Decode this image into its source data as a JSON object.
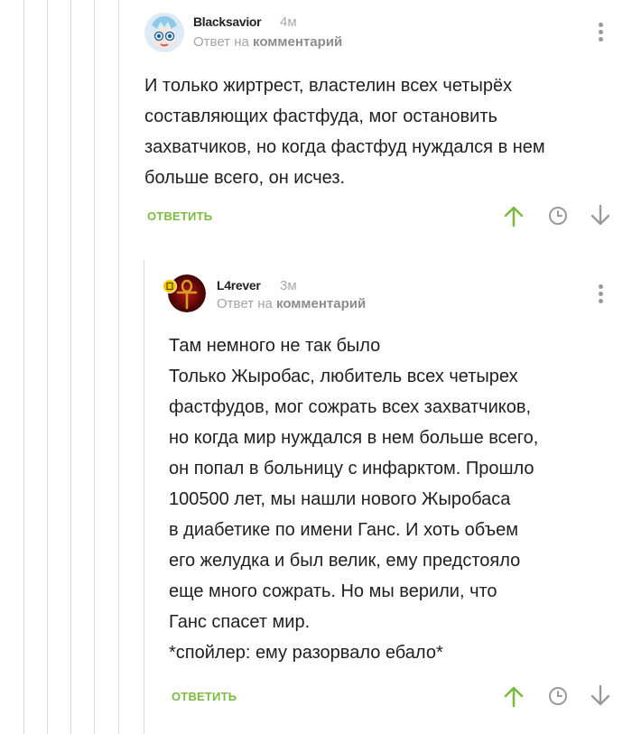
{
  "comments": [
    {
      "author": "Blacksavior",
      "time": "4м",
      "reply_prefix": "Ответ на",
      "reply_target": "комментарий",
      "text": "И только жиртрест, властелин всех четырёх\nсоставляющих фастфуда, мог остановить\nзахватчиков, но когда фастфуд нуждался в нем\nбольше всего, он исчез.",
      "reply_label": "ОТВЕТИТЬ"
    },
    {
      "author": "L4rever",
      "time": "3м",
      "reply_prefix": "Ответ на",
      "reply_target": "комментарий",
      "text": "Там немного не так было\nТолько Жыробас, любитель всех четырех\nфастфудов, мог сожрать всех захватчиков,\nно когда мир нуждался в нем больше всего,\nон попал в больницу с инфарктом. Прошло\n100500 лет, мы нашли нового Жыробаса\nв диабетике по имени Ганс. И хоть объем\nего желудка и был велик, ему предстояло\nеще много сожрать. Но мы верили, что\nГанс спасет мир.\n*спойлер: ему разорвало ебало*",
      "reply_label": "ОТВЕТИТЬ"
    }
  ],
  "icons": {
    "upvote": "arrow-up-icon",
    "save": "clock-icon",
    "downvote": "arrow-down-icon",
    "menu": "more-vertical-icon"
  },
  "colors": {
    "accent_green": "#7cba3f",
    "muted_gray": "#a3a3a3",
    "thread_line": "#d9d9d9"
  }
}
